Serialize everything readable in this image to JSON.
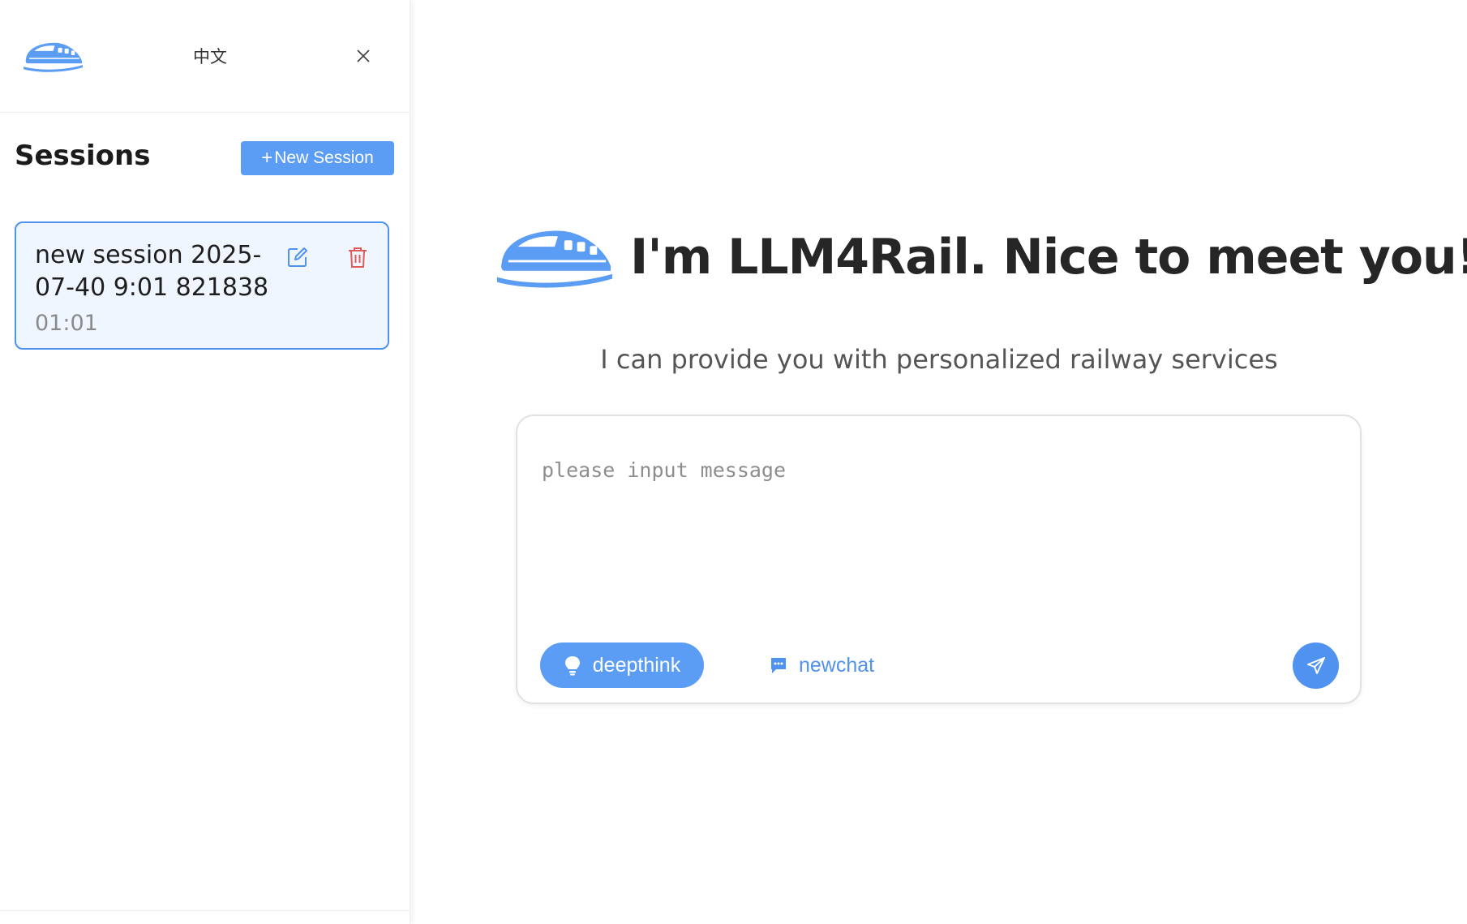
{
  "sidebar": {
    "language_toggle": "中文",
    "sessions_title": "Sessions",
    "new_session_plus": "+",
    "new_session_label": "New Session",
    "sessions": [
      {
        "title": "new session 2025-07-40 9:01 821838",
        "time": "01:01"
      }
    ]
  },
  "main": {
    "title": "I'm LLM4Rail. Nice to meet you!",
    "subtitle": "I can provide you with personalized railway services",
    "input": {
      "placeholder": "please input message",
      "value": ""
    },
    "deepthink_label": "deepthink",
    "newchat_label": "newchat"
  },
  "icons": {
    "logo": "train-icon",
    "close": "close-icon",
    "edit": "edit-icon",
    "delete": "trash-icon",
    "deepthink": "bulb-icon",
    "newchat": "chat-bubble-icon",
    "send": "send-icon"
  },
  "colors": {
    "accent": "#5b9cf5",
    "accent_dark": "#4f92ef",
    "danger": "#e05a5a",
    "session_bg": "#f0f6ff"
  }
}
